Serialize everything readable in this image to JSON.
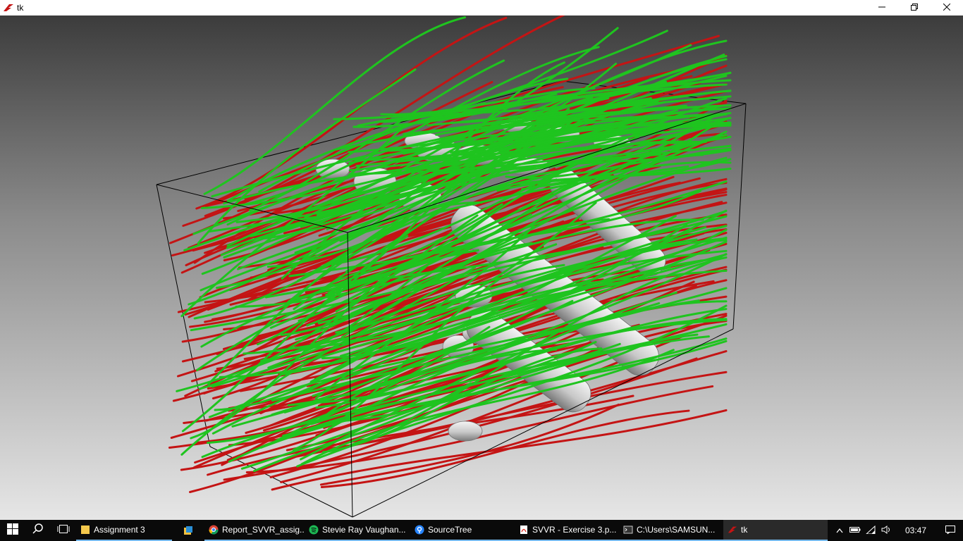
{
  "window": {
    "title": "tk",
    "app_icon": "tk-feather-icon",
    "controls": [
      "minimize-icon",
      "restore-icon",
      "close-icon"
    ]
  },
  "scene": {
    "description_colors": {
      "background_top": "#3c3c3c",
      "background_bottom": "#e6e6e6",
      "streamline_a": "#1fc41f",
      "streamline_b": "#c41414",
      "obstacles": "#c8c8c8",
      "bounding_box": "#000000"
    }
  },
  "taskbar": {
    "start_icon": "windows-logo-icon",
    "search_icon": "search-icon",
    "taskview_icon": "task-view-icon",
    "items": [
      {
        "label": "Assignment 3",
        "icon": "folder-icon",
        "color": "#f5c84c"
      },
      {
        "label": "",
        "icon": "files-icon",
        "color": "#f0c040"
      },
      {
        "label": "Report_SVVR_assig...",
        "icon": "chrome-icon",
        "color": "#4caf50"
      },
      {
        "label": "Stevie Ray Vaughan...",
        "icon": "spotify-icon",
        "color": "#1db954"
      },
      {
        "label": "SourceTree",
        "icon": "sourcetree-icon",
        "color": "#2684ff"
      },
      {
        "label": "SVVR - Exercise 3.p...",
        "icon": "pdf-icon",
        "color": "#e0281c"
      },
      {
        "label": "C:\\Users\\SAMSUN...",
        "icon": "console-icon",
        "color": "#c8c8c8"
      },
      {
        "label": "tk",
        "icon": "tk-feather-icon",
        "color": "#c41414"
      }
    ],
    "tray": {
      "icons": [
        "chevron-up-icon",
        "battery-icon",
        "wifi-icon",
        "speaker-icon"
      ],
      "time": "03:47",
      "notification_icon": "notification-icon"
    }
  }
}
